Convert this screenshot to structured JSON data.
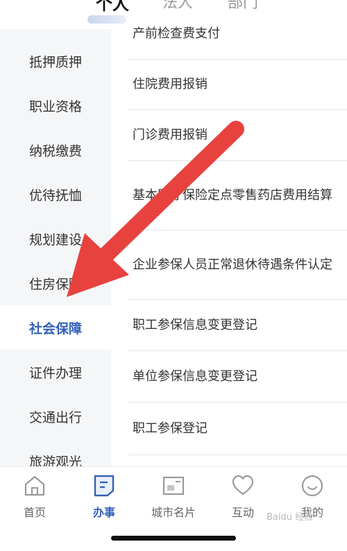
{
  "top_tabs": [
    {
      "label": "个人",
      "active": true
    },
    {
      "label": "法人",
      "active": false
    },
    {
      "label": "部门",
      "active": false
    }
  ],
  "sidebar": {
    "items": [
      {
        "label": "抵押质押",
        "active": false
      },
      {
        "label": "职业资格",
        "active": false
      },
      {
        "label": "纳税缴费",
        "active": false
      },
      {
        "label": "优待抚恤",
        "active": false
      },
      {
        "label": "规划建设",
        "active": false
      },
      {
        "label": "住房保障",
        "active": false
      },
      {
        "label": "社会保障",
        "active": true
      },
      {
        "label": "证件办理",
        "active": false
      },
      {
        "label": "交通出行",
        "active": false
      },
      {
        "label": "旅游观光",
        "active": false
      }
    ]
  },
  "list": {
    "items": [
      {
        "label": "产前检查费支付"
      },
      {
        "label": "住院费用报销"
      },
      {
        "label": "门诊费用报销"
      },
      {
        "label": "基本医疗保险定点零售药店费用结算"
      },
      {
        "label": "企业参保人员正常退休待遇条件认定"
      },
      {
        "label": "职工参保信息变更登记"
      },
      {
        "label": "单位参保信息变更登记"
      },
      {
        "label": "职工参保登记"
      }
    ]
  },
  "bottom_nav": {
    "items": [
      {
        "label": "首页",
        "icon": "home-icon",
        "active": false
      },
      {
        "label": "办事",
        "icon": "document-icon",
        "active": true
      },
      {
        "label": "城市名片",
        "icon": "card-icon",
        "active": false
      },
      {
        "label": "互动",
        "icon": "heart-icon",
        "active": false
      },
      {
        "label": "我的",
        "icon": "smile-icon",
        "active": false
      }
    ]
  },
  "colors": {
    "accent": "#3360b8",
    "sidebar_bg": "#f5f6f8",
    "arrow": "#e8423f"
  },
  "watermark": "Baidu 经验"
}
